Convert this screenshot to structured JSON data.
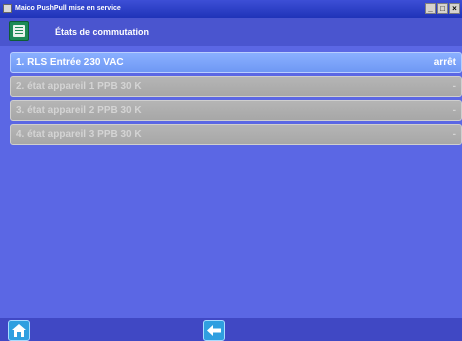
{
  "window": {
    "title": "Maico PushPull mise en service",
    "controls": [
      "_",
      "□",
      "×"
    ]
  },
  "header": {
    "title": "États de commutation",
    "menu_icon": "list-panel-icon"
  },
  "rows": [
    {
      "label": "1. RLS Entrée 230 VAC",
      "value": "arrêt",
      "state": "active"
    },
    {
      "label": "2. état appareil 1 PPB 30 K",
      "value": "-",
      "state": "disabled"
    },
    {
      "label": "3. état appareil 2 PPB 30 K",
      "value": "-",
      "state": "disabled"
    },
    {
      "label": "4. état appareil 3 PPB 30 K",
      "value": "-",
      "state": "disabled"
    }
  ],
  "footer": {
    "home_icon": "home-icon",
    "back_icon": "back-arrow-icon"
  },
  "colors": {
    "background": "#5b67e4",
    "active_row": "#7ea4f8",
    "disabled_row": "#aeaeae",
    "button": "#2f9fe0"
  }
}
